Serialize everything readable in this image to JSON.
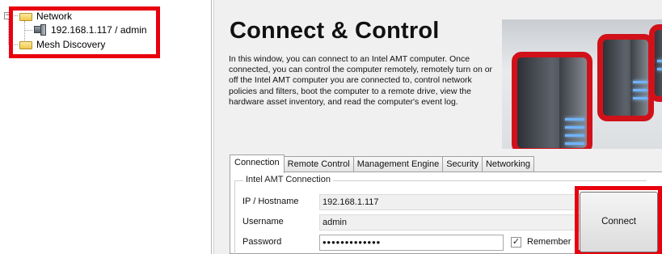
{
  "tree": {
    "expander_glyph": "−",
    "network_label": "Network",
    "host_label": "192.168.1.117 / admin",
    "mesh_label": "Mesh Discovery",
    "icons": [
      "folder-icon",
      "computer-icon",
      "folder-icon"
    ]
  },
  "main": {
    "title": "Connect & Control",
    "description": "In this window, you can connect to an Intel AMT computer. Once connected, you can control the computer remotely, remotely turn on or off the Intel AMT computer you are connected to, control network policies and filters, boot the computer to a remote drive, view the hardware asset inventory, and read the computer's event log.",
    "tabs": [
      {
        "label": "Connection",
        "active": true
      },
      {
        "label": "Remote Control",
        "active": false
      },
      {
        "label": "Management Engine",
        "active": false
      },
      {
        "label": "Security",
        "active": false
      },
      {
        "label": "Networking",
        "active": false
      }
    ],
    "group_title": "Intel AMT Connection",
    "fields": {
      "host_label": "IP / Hostname",
      "host_value": "192.168.1.117",
      "user_label": "Username",
      "user_value": "admin",
      "password_label": "Password",
      "password_value": "•••••••••••••"
    },
    "remember_label": "Remember",
    "remember_checked": true,
    "check_glyph": "✓",
    "connect_label": "Connect"
  },
  "colors": {
    "highlight": "#e8000e",
    "panel_bg": "#f0f0f0"
  }
}
